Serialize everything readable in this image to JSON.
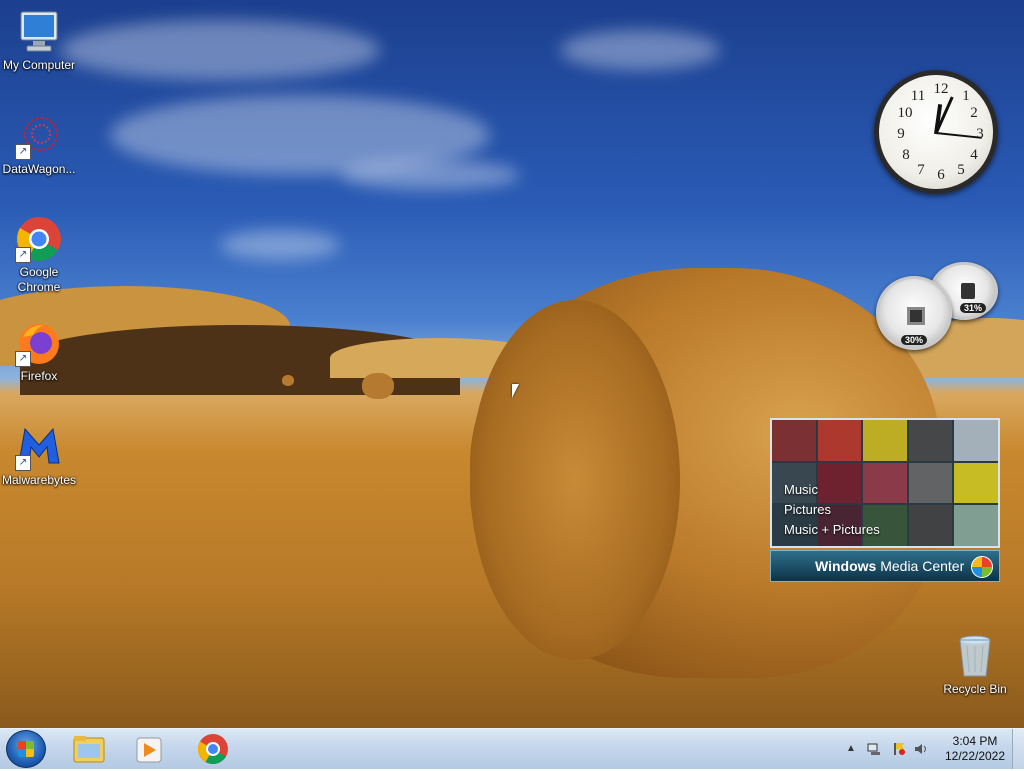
{
  "desktop": {
    "icons": [
      {
        "label": "My Computer",
        "icon": "computer-icon"
      },
      {
        "label": "DataWagon...",
        "icon": "datawagon-icon"
      },
      {
        "label": "Google Chrome",
        "icon": "chrome-icon"
      },
      {
        "label": "Firefox",
        "icon": "firefox-icon"
      },
      {
        "label": "Malwarebytes",
        "icon": "malwarebytes-icon"
      },
      {
        "label": "Recycle Bin",
        "icon": "recycle-bin-icon"
      }
    ]
  },
  "gadgets": {
    "clock": {
      "numerals": [
        "12",
        "1",
        "2",
        "3",
        "4",
        "5",
        "6",
        "7",
        "8",
        "9",
        "10",
        "11"
      ],
      "time": "3:04"
    },
    "cpu_meter": {
      "cpu_label": "30%",
      "cpu_value": 30,
      "memory_label": "31%",
      "memory_value": 31
    },
    "media_center": {
      "menu": [
        "Music",
        "Pictures",
        "Music + Pictures"
      ],
      "brand_bold": "Windows",
      "brand_light": "Media Center"
    }
  },
  "taskbar": {
    "pinned": [
      "file-explorer-icon",
      "media-player-icon",
      "chrome-icon"
    ],
    "tray_icons": [
      "show-hidden-icons-icon",
      "network-icon",
      "action-center-icon",
      "volume-icon"
    ],
    "time": "3:04 PM",
    "date": "12/22/2022"
  },
  "colors": {
    "sky": "#1c3f8e",
    "taskbar": "#c5d7ec",
    "accent": "#1f5eb4"
  }
}
